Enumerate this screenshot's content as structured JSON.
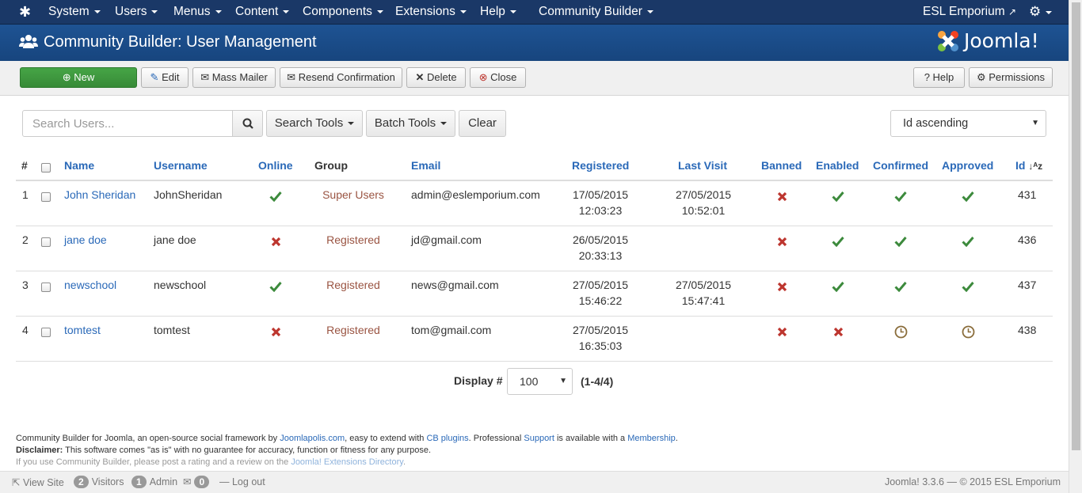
{
  "topnav": {
    "menus": [
      "System",
      "Users",
      "Menus",
      "Content",
      "Components",
      "Extensions",
      "Help",
      "Community Builder"
    ],
    "site_name": "ESL Emporium"
  },
  "title": "Community Builder: User Management",
  "brand": "Joomla!",
  "toolbar": {
    "new": "New",
    "edit": "Edit",
    "mass_mailer": "Mass Mailer",
    "resend": "Resend Confirmation",
    "delete": "Delete",
    "close": "Close",
    "help": "Help",
    "permissions": "Permissions"
  },
  "filters": {
    "search_placeholder": "Search Users...",
    "search_tools": "Search Tools",
    "batch_tools": "Batch Tools",
    "clear": "Clear",
    "sort": "Id ascending"
  },
  "table": {
    "columns": {
      "num": "#",
      "name": "Name",
      "username": "Username",
      "online": "Online",
      "group": "Group",
      "email": "Email",
      "registered": "Registered",
      "last_visit": "Last Visit",
      "banned": "Banned",
      "enabled": "Enabled",
      "confirmed": "Confirmed",
      "approved": "Approved",
      "id": "Id"
    },
    "rows": [
      {
        "num": "1",
        "name": "John Sheridan",
        "username": "JohnSheridan",
        "online": "yes",
        "group": "Super Users",
        "email": "admin@eslemporium.com",
        "reg_date": "17/05/2015",
        "reg_time": "12:03:23",
        "lv_date": "27/05/2015",
        "lv_time": "10:52:01",
        "banned": "no",
        "enabled": "yes",
        "confirmed": "yes",
        "approved": "yes",
        "id": "431"
      },
      {
        "num": "2",
        "name": "jane doe",
        "username": "jane doe",
        "online": "no",
        "group": "Registered",
        "email": "jd@gmail.com",
        "reg_date": "26/05/2015",
        "reg_time": "20:33:13",
        "lv_date": "",
        "lv_time": "",
        "banned": "no",
        "enabled": "yes",
        "confirmed": "yes",
        "approved": "yes",
        "id": "436"
      },
      {
        "num": "3",
        "name": "newschool",
        "username": "newschool",
        "online": "yes",
        "group": "Registered",
        "email": "news@gmail.com",
        "reg_date": "27/05/2015",
        "reg_time": "15:46:22",
        "lv_date": "27/05/2015",
        "lv_time": "15:47:41",
        "banned": "no",
        "enabled": "yes",
        "confirmed": "yes",
        "approved": "yes",
        "id": "437"
      },
      {
        "num": "4",
        "name": "tomtest",
        "username": "tomtest",
        "online": "no",
        "group": "Registered",
        "email": "tom@gmail.com",
        "reg_date": "27/05/2015",
        "reg_time": "16:35:03",
        "lv_date": "",
        "lv_time": "",
        "banned": "no",
        "enabled": "no",
        "confirmed": "pending",
        "approved": "pending",
        "id": "438"
      }
    ]
  },
  "pagination": {
    "label": "Display #",
    "value": "100",
    "range": "(1-4/4)"
  },
  "footer": {
    "l1_a": "Community Builder for Joomla, an open-source social framework by ",
    "l1_link1": "Joomlapolis.com",
    "l1_b": ", easy to extend with ",
    "l1_link2": "CB plugins",
    "l1_c": ". Professional ",
    "l1_link3": "Support",
    "l1_d": " is available with a ",
    "l1_link4": "Membership",
    "l1_e": ".",
    "l2_bold": "Disclaimer:",
    "l2_text": " This software comes \"as is\" with no guarantee for accuracy, function or fitness for any purpose.",
    "l3_text": "If you use Community Builder, please post a rating and a review on the ",
    "l3_link": "Joomla! Extensions Directory",
    "l3_end": "."
  },
  "status": {
    "view_site": "View Site",
    "visitors_count": "2",
    "visitors": "Visitors",
    "admin_count": "1",
    "admin": "Admin",
    "messages_count": "0",
    "logout": "Log out",
    "version": "Joomla! 3.3.6 — © 2015 ESL Emporium"
  },
  "colors": {
    "nav": "#1a3867",
    "header": "#1e5393",
    "green": "#3c8a3c",
    "red": "#bd362f",
    "pending": "#8a6d3b",
    "link": "#2a69b8",
    "group": "#9a5442"
  }
}
